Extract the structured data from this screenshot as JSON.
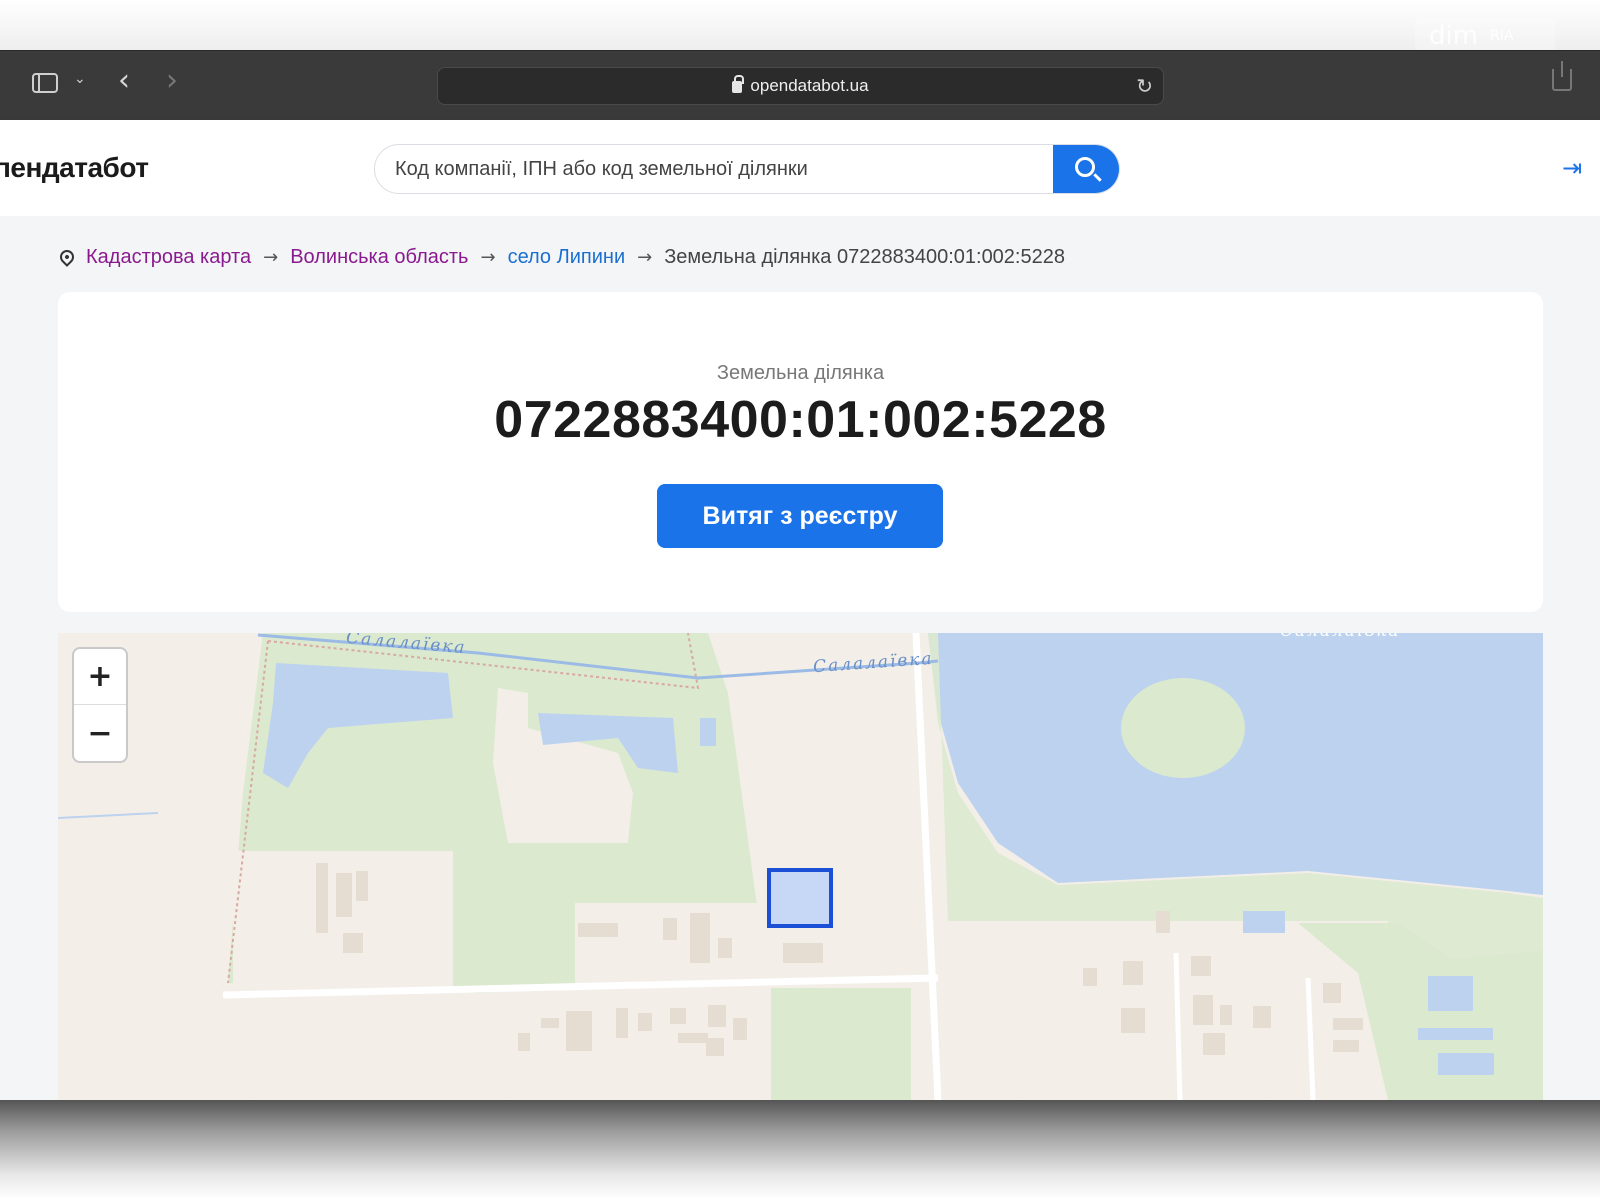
{
  "browser": {
    "url": "opendatabot.ua"
  },
  "watermark": {
    "text": "dim",
    "subtext": "RIA"
  },
  "header": {
    "logo": "пендатабот",
    "search_placeholder": "Код компанії, ІПН або код земельної ділянки"
  },
  "breadcrumb": {
    "items": [
      {
        "label": "Кадастрова карта"
      },
      {
        "label": "Волинська область"
      },
      {
        "label": "село Липини"
      },
      {
        "label": "Земельна ділянка 0722883400:01:002:5228"
      }
    ]
  },
  "card": {
    "subtitle": "Земельна ділянка",
    "title": "0722883400:01:002:5228",
    "button_label": "Витяг з реєстру"
  },
  "map": {
    "zoom_in": "+",
    "zoom_out": "−",
    "river_label_1": "Салалаївка",
    "river_label_2": "Салалаївка",
    "river_label_3": "Салалаївка",
    "colors": {
      "water": "#bcd2ee",
      "park": "#dbe9cf",
      "land": "#f3efe8",
      "parcel_fill": "#c6d8f5",
      "parcel_border": "#1a4fd6",
      "road": "#ffffff",
      "building": "#e6ddd2"
    }
  },
  "icons": {
    "sidebar": "sidebar-icon",
    "back": "back-icon",
    "forward": "forward-icon",
    "lock": "lock-icon",
    "reload": "reload-icon",
    "share": "share-icon",
    "search": "search-icon",
    "login": "login-icon",
    "pin": "pin-icon"
  }
}
